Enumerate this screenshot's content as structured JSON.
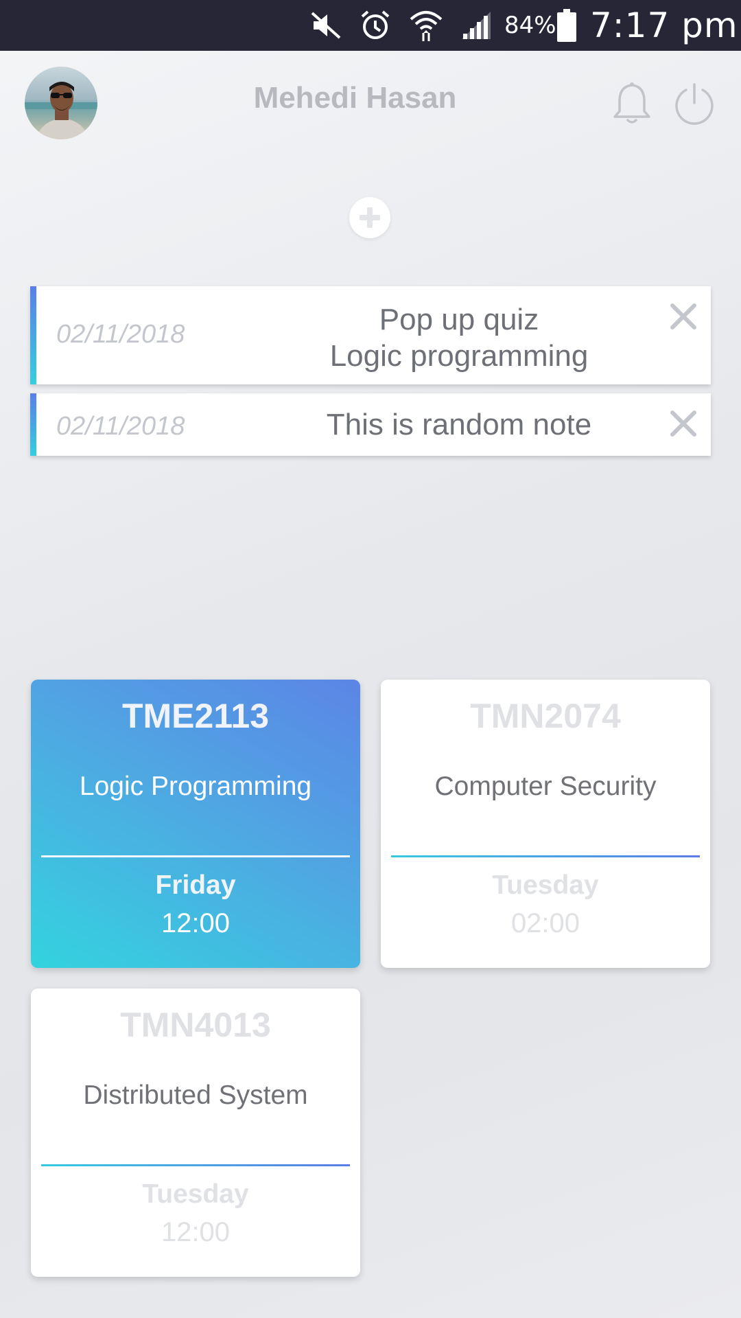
{
  "status_bar": {
    "battery_percent": "84%",
    "time": "7:17 pm",
    "icons": [
      "mute-icon",
      "alarm-icon",
      "wifi-icon",
      "signal-icon",
      "battery-icon"
    ]
  },
  "header": {
    "user_name": "Mehedi Hasan",
    "icons": [
      "avatar",
      "bell-icon",
      "power-icon"
    ]
  },
  "add_button": {
    "icon": "plus-icon"
  },
  "notes": [
    {
      "date": "02/11/2018",
      "line1": "Pop up quiz",
      "line2": "Logic programming",
      "close_icon": "close-icon"
    },
    {
      "date": "02/11/2018",
      "text": "This is random note",
      "close_icon": "close-icon"
    }
  ],
  "courses": [
    {
      "code": "TME2113",
      "name": "Logic Programming",
      "day": "Friday",
      "time": "12:00",
      "active": true
    },
    {
      "code": "TMN2074",
      "name": "Computer Security",
      "day": "Tuesday",
      "time": "02:00",
      "active": false
    },
    {
      "code": "TMN4013",
      "name": "Distributed System",
      "day": "Tuesday",
      "time": "12:00",
      "active": false
    }
  ],
  "colors": {
    "status_bar": "#262637",
    "accent_blue": "#5b85e6",
    "accent_cyan": "#33d3df",
    "muted_text": "#dfe1e5"
  }
}
